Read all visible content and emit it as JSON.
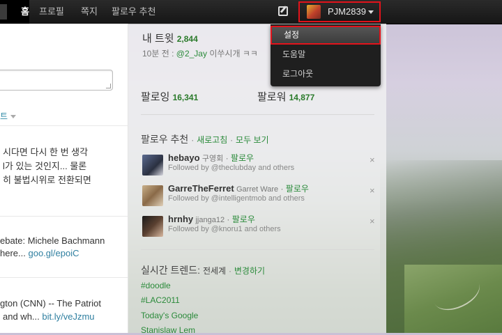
{
  "nav": {
    "home": "홈",
    "profile": "프로필",
    "messages": "쪽지",
    "who_to_follow": "팔로우 추천"
  },
  "account": {
    "username": "PJM2839"
  },
  "dropdown": {
    "items": [
      "설정",
      "도움말",
      "로그아웃"
    ]
  },
  "timeline": {
    "tab_label": "트",
    "tweets": [
      {
        "lines": [
          "시다면 다시 한 번 생각",
          "l가 있는 것인지... 물론",
          "히 불법시위로 전환되면"
        ]
      },
      {
        "lines": [
          "ebate: Michele Bachmann",
          "here..."
        ],
        "link": "goo.gl/epoiC"
      },
      {
        "lines": [
          "gton (CNN) -- The Patriot",
          "and wh..."
        ],
        "link": "bit.ly/veJzmu"
      }
    ]
  },
  "dashboard": {
    "my_tweets_label": "내 트윗",
    "my_tweets_count": "2,844",
    "last_tweet_time": "10분 전 :",
    "last_tweet_mention": "@2_Jay",
    "last_tweet_text": "이쑤시개 ㅋㅋ",
    "following_label": "팔로잉",
    "following_count": "16,341",
    "followers_label": "팔로워",
    "followers_count": "14,877",
    "recommend_title": "팔로우 추천",
    "recommend_refresh": "새로고침",
    "recommend_view_all": "모두 보기",
    "separator": "·",
    "follow_label": "팔로우",
    "followed_by_prefix": "Followed by",
    "and_others": "and others",
    "recommendations": [
      {
        "screen_name": "hebayo",
        "real_name": "구영회",
        "followed_by": "@theclubday"
      },
      {
        "screen_name": "GarreTheFerret",
        "real_name": "Garret Ware",
        "followed_by": "@intelligentmob"
      },
      {
        "screen_name": "hrnhy",
        "real_name": "jjanga12",
        "followed_by": "@knoru1"
      }
    ],
    "trends_title": "실시간 트렌드:",
    "trends_scope": "전세계",
    "trends_change": "변경하기",
    "trends": [
      "#doodle",
      "#LAC2011",
      "Today's Google",
      "Stanislaw Lem"
    ]
  },
  "icons": {
    "compose": "compose-icon",
    "caret": "chevron-down-icon",
    "close": "close-icon"
  },
  "colors": {
    "highlight_border": "#e3131b",
    "link_green": "#2a8a3a",
    "topbar": "#1a1a1a"
  }
}
